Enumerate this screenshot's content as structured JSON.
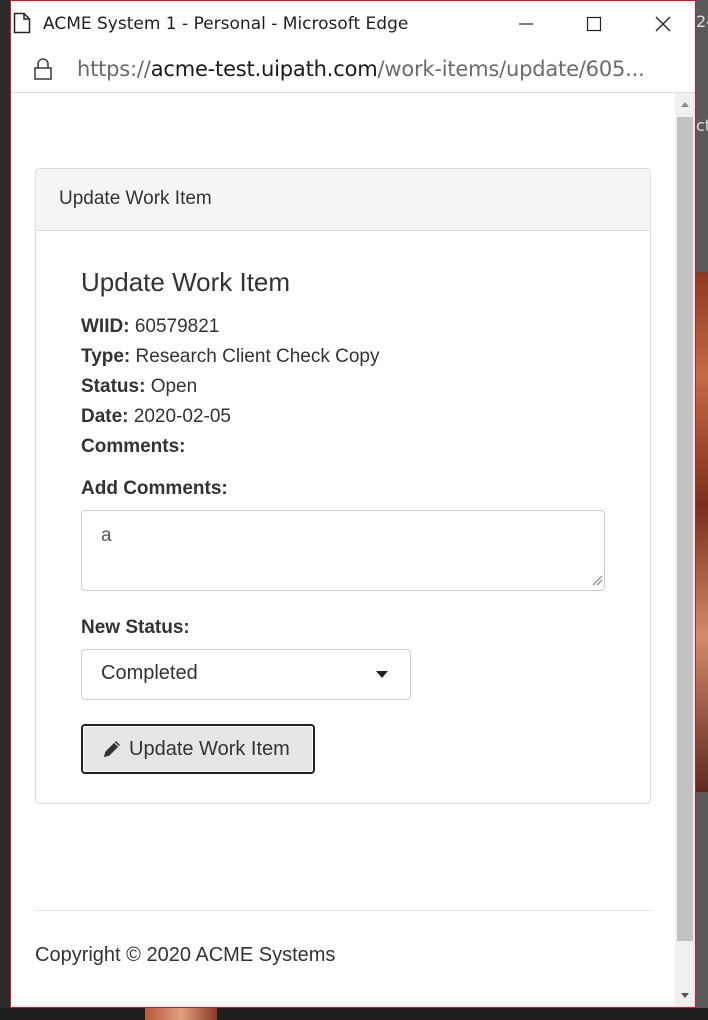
{
  "browser": {
    "window_title": "ACME System 1 - Personal - Microsoft Edge",
    "url_scheme": "https://",
    "url_host": "acme-test.uipath.com",
    "url_path": "/work-items/update/605..."
  },
  "panel": {
    "heading": "Update Work Item",
    "title": "Update Work Item",
    "wiid_label": "WIID:",
    "wiid_value": "60579821",
    "type_label": "Type:",
    "type_value": "Research Client Check Copy",
    "status_label": "Status:",
    "status_value": "Open",
    "date_label": "Date:",
    "date_value": "2020-02-05",
    "comments_label": "Comments:",
    "add_comments_label": "Add Comments:",
    "add_comments_value": "a",
    "new_status_label": "New Status:",
    "new_status_selected": "Completed",
    "update_button_label": "Update Work Item"
  },
  "footer": {
    "copyright": "Copyright © 2020 ACME Systems"
  },
  "background": {
    "right_fragment_top": "24",
    "right_fragment_mid": "ct"
  },
  "colors": {
    "window_border": "#e81123",
    "panel_heading_bg": "#f5f5f5",
    "button_bg": "#e6e6e6"
  }
}
